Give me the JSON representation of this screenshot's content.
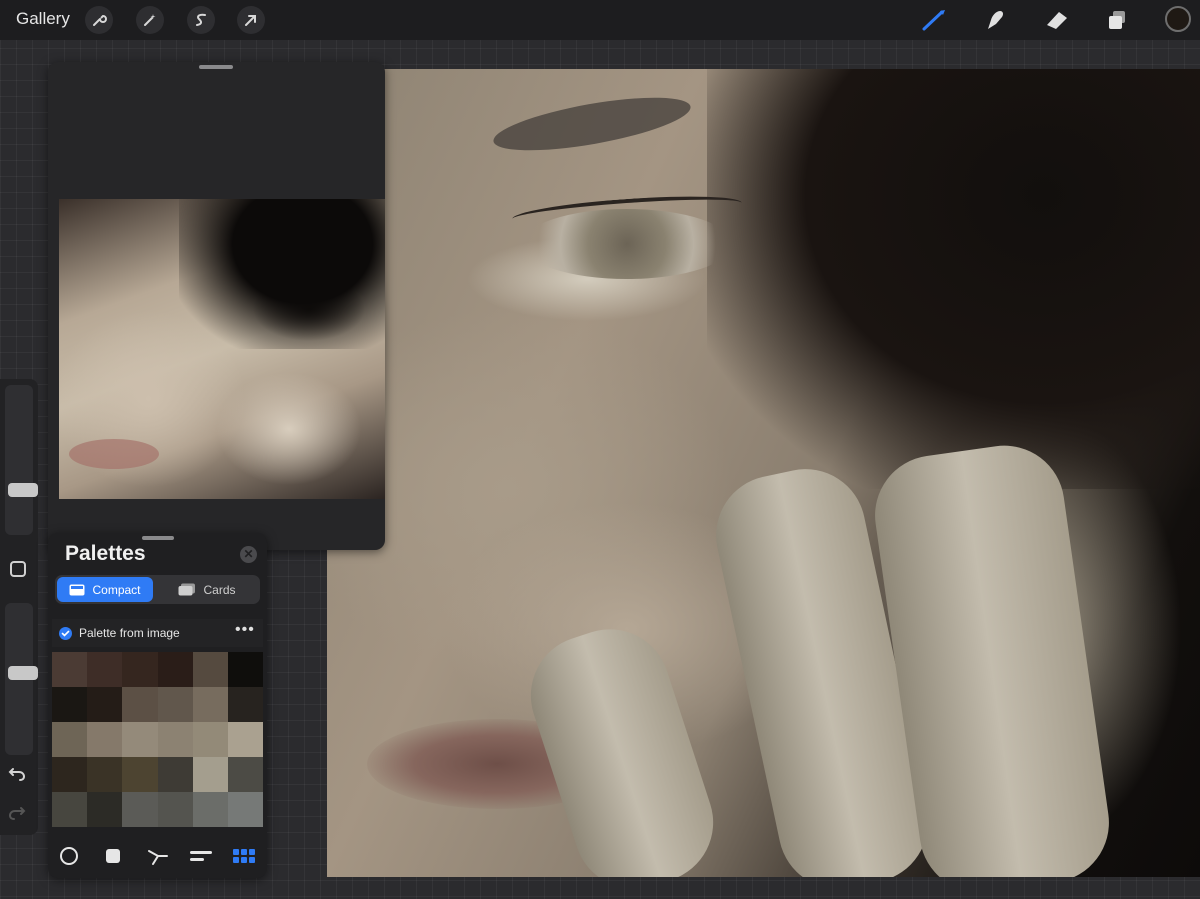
{
  "app": {
    "gallery_label": "Gallery",
    "left_tools": [
      "wrench-icon",
      "magic-wand-icon",
      "selection-icon",
      "transform-arrow-icon"
    ],
    "right_tools": [
      "brush-icon",
      "smudge-icon",
      "eraser-icon",
      "layers-icon"
    ],
    "active_color": "#1f1914",
    "accent_color": "#2f7bf5"
  },
  "palettes": {
    "title": "Palettes",
    "modes": [
      {
        "label": "Compact",
        "active": true
      },
      {
        "label": "Cards",
        "active": false
      }
    ],
    "palette_name": "Palette from image",
    "more_label": "•••",
    "swatches": [
      "#4b3b34",
      "#3e2d27",
      "#35261f",
      "#2a1d18",
      "#554a3f",
      "#0f0e0c",
      "#1a1713",
      "#241c17",
      "#5c5045",
      "#61574c",
      "#776c5e",
      "#27231f",
      "#6e6556",
      "#85796a",
      "#948a7a",
      "#8c8272",
      "#938a78",
      "#aaa190",
      "#2d261e",
      "#3a3326",
      "#4d4431",
      "#3e3b35",
      "#a49e8e",
      "#4c4b45",
      "#47463f",
      "#2c2b26",
      "#5b5b57",
      "#54544f",
      "#6b6d69",
      "#767977"
    ],
    "footer_icons": [
      "disc-color-icon",
      "classic-color-icon",
      "harmony-icon",
      "value-icon",
      "palettes-grid-icon"
    ]
  },
  "sidebar": {
    "size_slider_level": 0.28,
    "opacity_slider_level": 0.54
  }
}
